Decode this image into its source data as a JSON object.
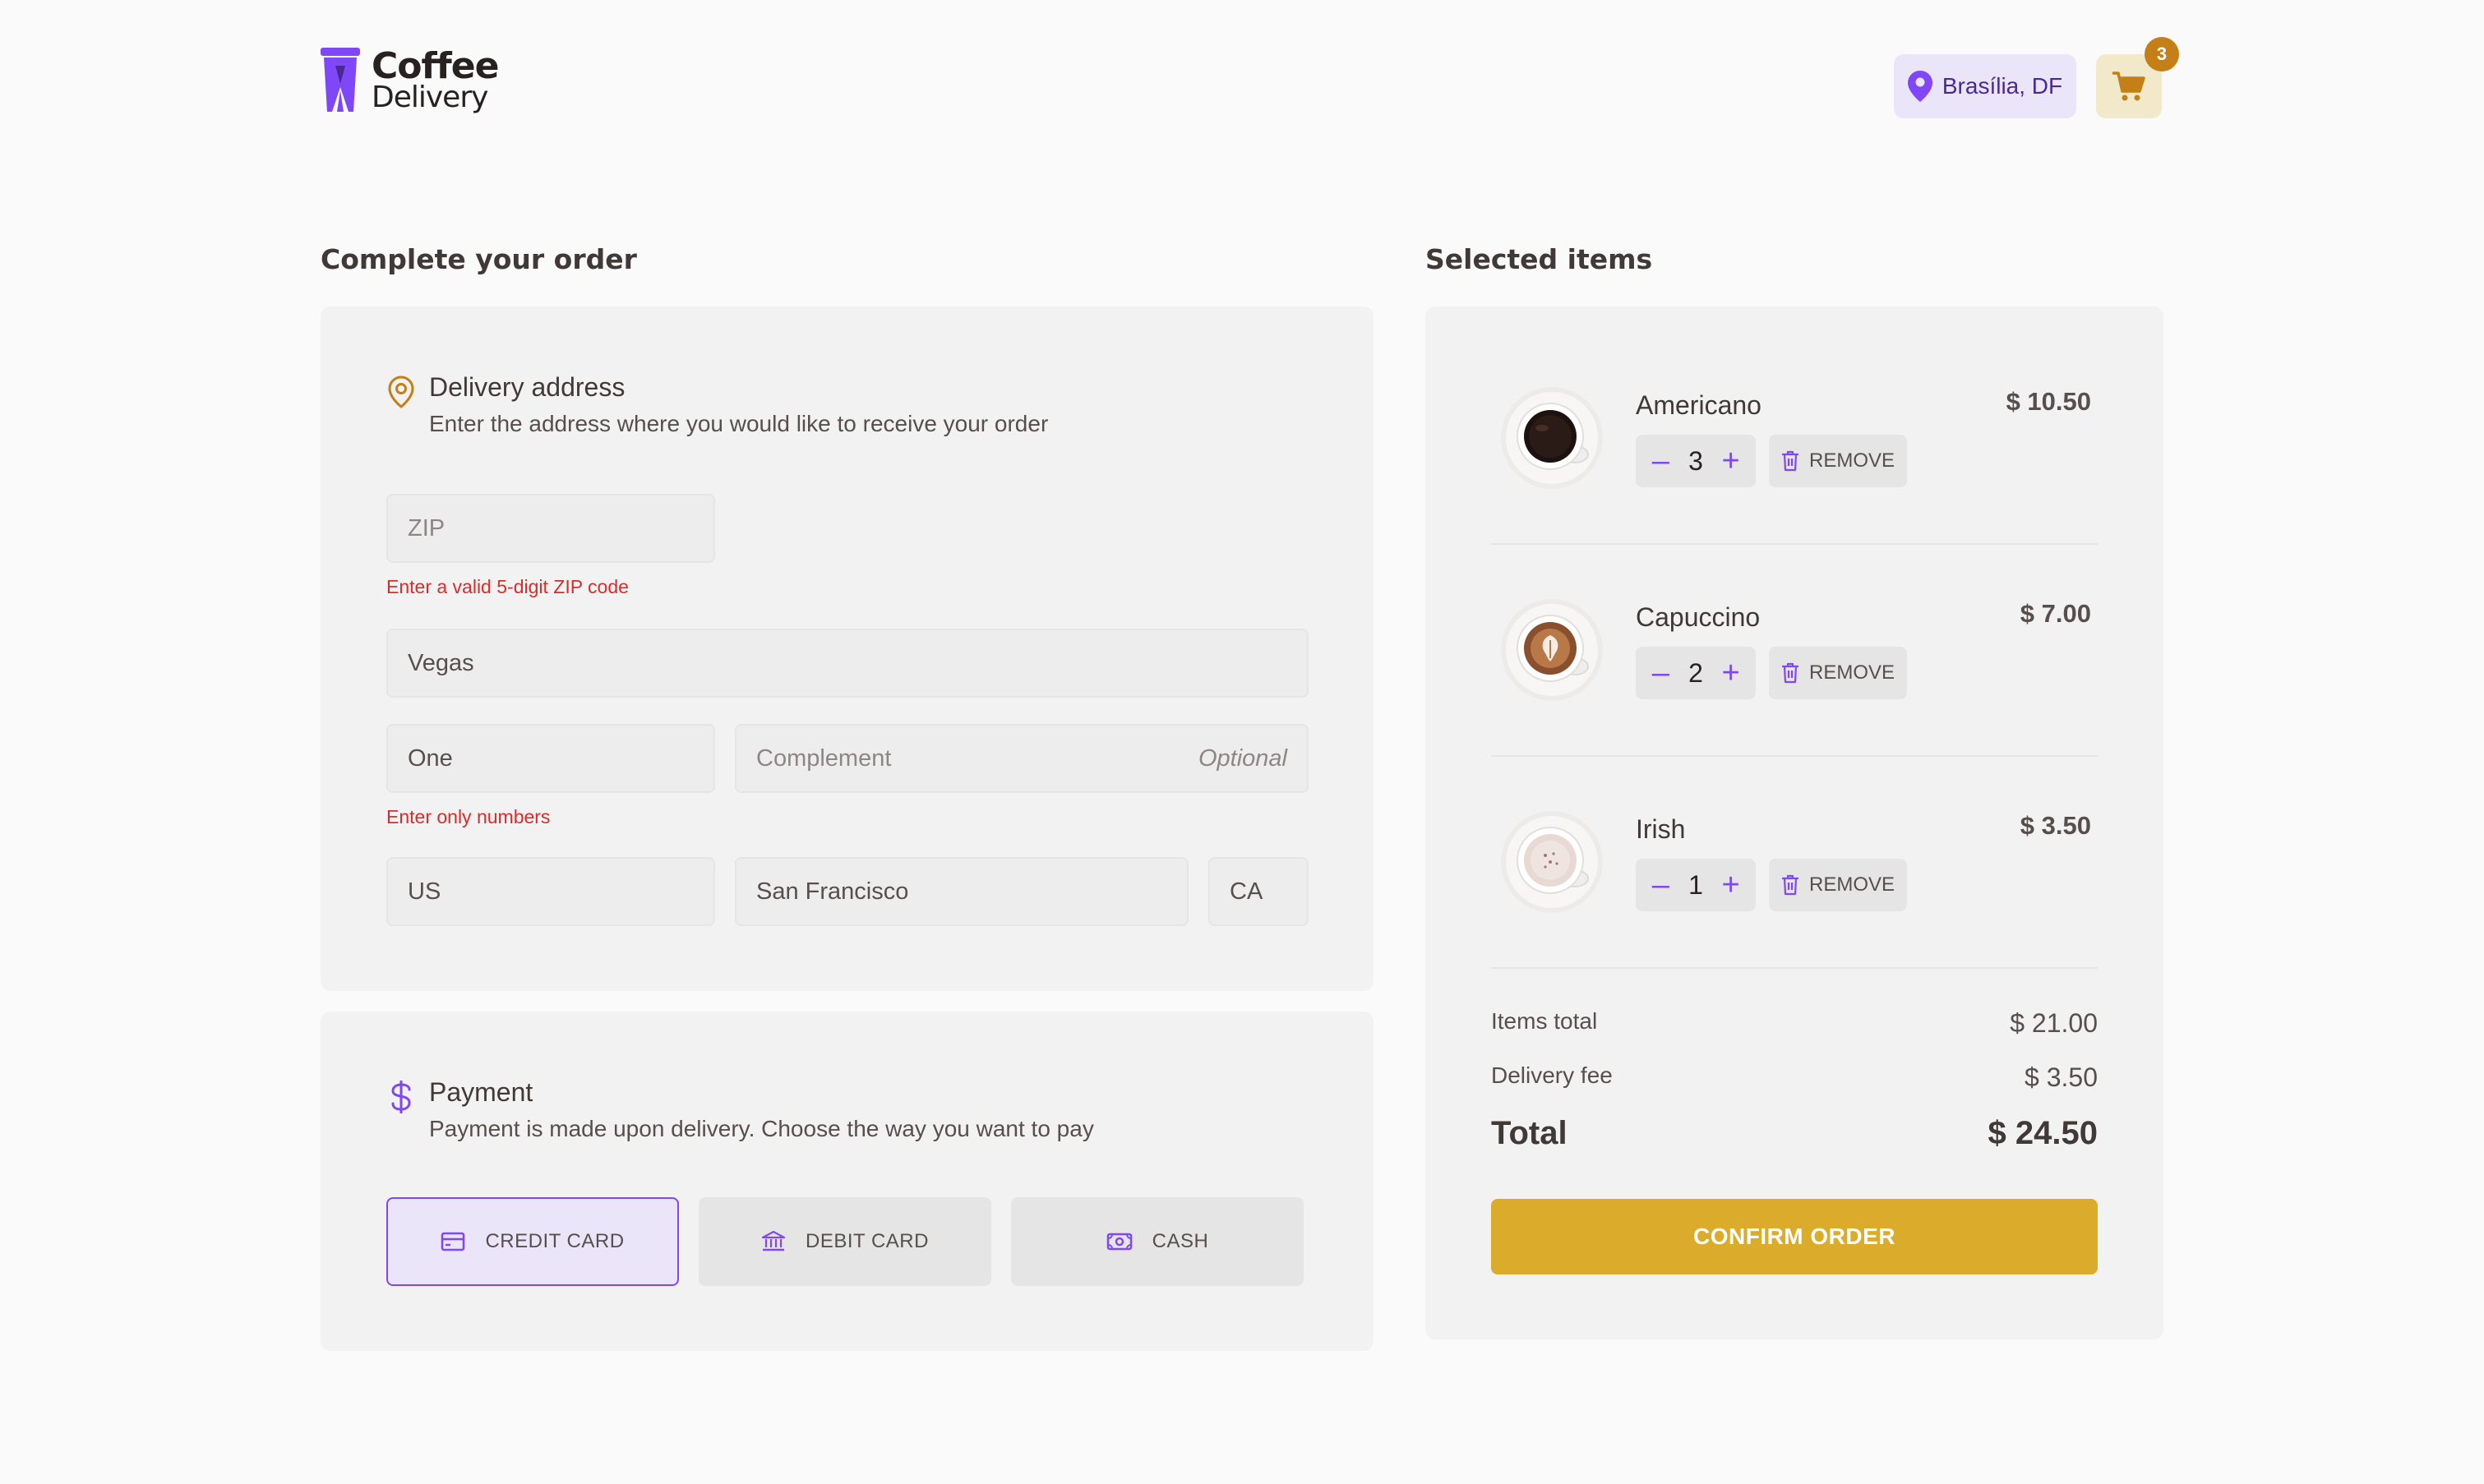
{
  "header": {
    "logo_line1": "Coffee",
    "logo_line2": "Delivery",
    "location": "Brasília, DF",
    "cart_count": "3"
  },
  "checkout": {
    "title": "Complete your order",
    "address": {
      "heading": "Delivery address",
      "subheading": "Enter the address where you would like to receive your order",
      "zip_placeholder": "ZIP",
      "zip_error": "Enter a valid 5-digit ZIP code",
      "street_value": "Vegas",
      "number_value": "One",
      "number_error": "Enter only numbers",
      "complement_placeholder": "Complement",
      "complement_optional": "Optional",
      "country_value": "US",
      "city_value": "San Francisco",
      "state_value": "CA"
    },
    "payment": {
      "heading": "Payment",
      "subheading": "Payment is made upon delivery. Choose the way you want to pay",
      "options": [
        {
          "label": "CREDIT CARD",
          "selected": true,
          "icon": "credit-card-icon"
        },
        {
          "label": "DEBIT CARD",
          "selected": false,
          "icon": "bank-icon"
        },
        {
          "label": "CASH",
          "selected": false,
          "icon": "money-icon"
        }
      ]
    }
  },
  "cart": {
    "title": "Selected items",
    "remove_label": "REMOVE",
    "items": [
      {
        "name": "Americano",
        "qty": "3",
        "price": "$ 10.50"
      },
      {
        "name": "Capuccino",
        "qty": "2",
        "price": "$ 7.00"
      },
      {
        "name": "Irish",
        "qty": "1",
        "price": "$ 3.50"
      }
    ],
    "summary": {
      "items_total_label": "Items total",
      "items_total_value": "$ 21.00",
      "delivery_label": "Delivery fee",
      "delivery_value": "$ 3.50",
      "total_label": "Total",
      "total_value": "$ 24.50"
    },
    "confirm_label": "CONFIRM ORDER"
  },
  "colors": {
    "purple": "#8047f8",
    "purple_dark": "#4b2995",
    "yellow": "#dbac2c",
    "yellow_dark": "#c47f17",
    "error": "#d32f2f"
  }
}
